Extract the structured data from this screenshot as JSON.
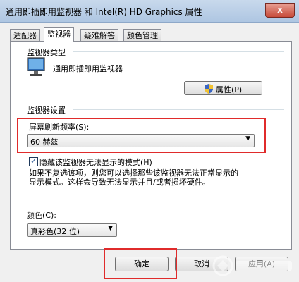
{
  "window": {
    "title": "通用即插即用监视器 和 Intel(R) HD Graphics 属性",
    "close": "x"
  },
  "tabs": [
    {
      "label": "适配器"
    },
    {
      "label": "监视器"
    },
    {
      "label": "疑难解答"
    },
    {
      "label": "颜色管理"
    }
  ],
  "monitor_type": {
    "label": "监视器类型",
    "device_name": "通用即插即用监视器",
    "properties_button": "属性(P)"
  },
  "monitor_settings": {
    "label": "监视器设置",
    "refresh_label": "屏幕刷新频率(S):",
    "refresh_value": "60 赫兹",
    "hide_modes_label": "隐藏该监视器无法显示的模式(H)",
    "hide_modes_checked": true,
    "warning_text_line1": "如果不复选该项，则您可以选择那些该监视器无法正常显示的",
    "warning_text_line2": "显示模式。这样会导致无法显示并且/或者损坏硬件。"
  },
  "color": {
    "label": "颜色(C):",
    "value": "真彩色(32 位)"
  },
  "footer": {
    "ok_button": "确定",
    "cancel_button": "取消",
    "apply_button": "应用(A)"
  },
  "colors": {
    "highlight": "#e02b2b"
  }
}
